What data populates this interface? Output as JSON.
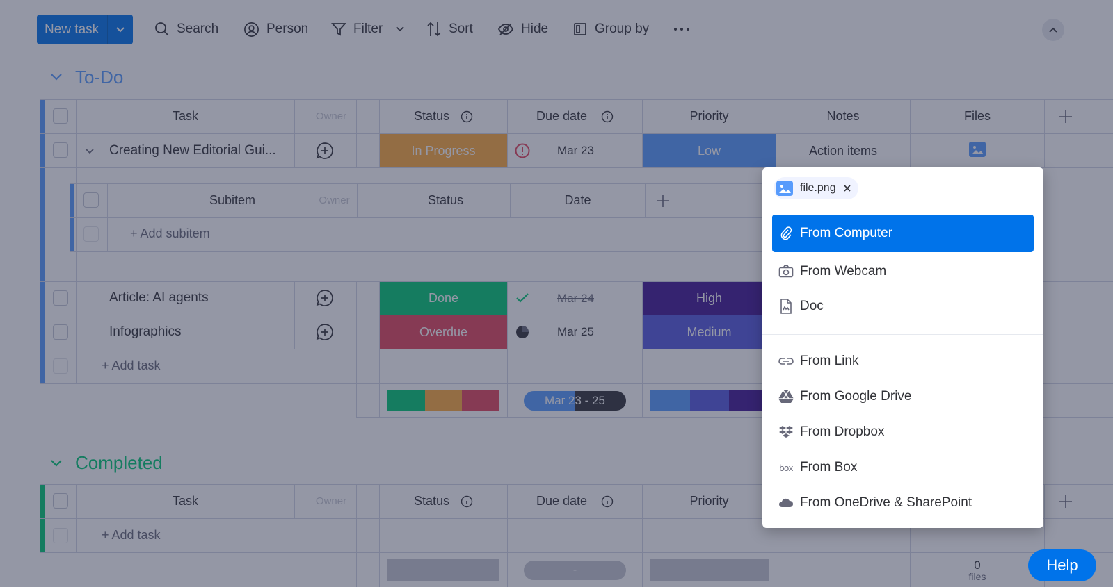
{
  "toolbar": {
    "new_task": "New task",
    "search": "Search",
    "person": "Person",
    "filter": "Filter",
    "sort": "Sort",
    "hide": "Hide",
    "group_by": "Group by"
  },
  "todo": {
    "title": "To-Do",
    "color": "#579bfc",
    "headers": {
      "task": "Task",
      "owner": "Owner",
      "status": "Status",
      "due": "Due date",
      "priority": "Priority",
      "notes": "Notes",
      "files": "Files"
    },
    "rows": [
      {
        "task": "Creating New Editorial Gui...",
        "status": "In Progress",
        "status_color": "#fdab3d",
        "due": "Mar 23",
        "priority": "Low",
        "priority_color": "#579bfc",
        "notes": "Action items"
      },
      {
        "task": "Article: AI agents",
        "status": "Done",
        "status_color": "#00c875",
        "due": "Mar 24",
        "priority": "High",
        "priority_color": "#401694"
      },
      {
        "task": "Infographics",
        "status": "Overdue",
        "status_color": "#e2445c",
        "due": "Mar 25",
        "priority": "Medium",
        "priority_color": "#5559df"
      }
    ],
    "subitems": {
      "headers": {
        "subitem": "Subitem",
        "owner": "Owner",
        "status": "Status",
        "date": "Date"
      },
      "add": "+ Add subitem"
    },
    "add_task": "+ Add task",
    "summary_date": "Mar 23 - 25"
  },
  "completed": {
    "title": "Completed",
    "color": "#00c875",
    "headers": {
      "task": "Task",
      "owner": "Owner",
      "status": "Status",
      "due": "Due date",
      "priority": "Priority"
    },
    "add_task": "+ Add task",
    "summary_dash": "-",
    "files_count": "0",
    "files_label": "files"
  },
  "menu": {
    "chip": "file.png",
    "items": [
      "From Computer",
      "From Webcam",
      "Doc",
      "From Link",
      "From Google Drive",
      "From Dropbox",
      "From Box",
      "From OneDrive & SharePoint"
    ],
    "box_logo": "box"
  },
  "help": "Help"
}
